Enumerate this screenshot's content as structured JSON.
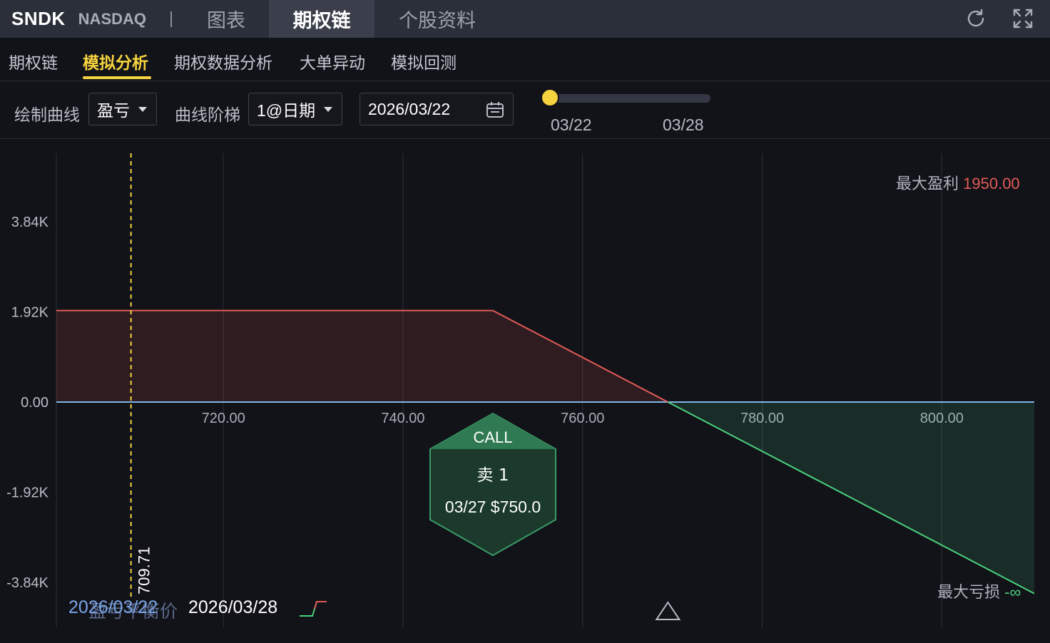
{
  "header": {
    "ticker": "SNDK",
    "exchange": "NASDAQ",
    "tabs": [
      "图表",
      "期权链",
      "个股资料"
    ],
    "active_tab": "期权链",
    "icons": [
      "refresh-icon",
      "fullscreen-icon"
    ]
  },
  "subtabs": {
    "items": [
      "期权链",
      "模拟分析",
      "期权数据分析",
      "大单异动",
      "模拟回测"
    ],
    "active": "模拟分析"
  },
  "controls": {
    "curve_label": "绘制曲线",
    "curve_value": "盈亏",
    "ladder_label": "曲线阶梯",
    "ladder_value": "1@日期",
    "date_value": "2026/03/22",
    "slider_start": "03/22",
    "slider_end": "03/28"
  },
  "chart": {
    "max_profit_label": "最大盈利",
    "max_profit_value": "1950.00",
    "max_loss_label": "最大亏损",
    "max_loss_value": "-∞",
    "current_price_label": "709.71",
    "legend_date_1": "2026/03/22",
    "legend_date_1_overlap": "盈亏平衡价",
    "legend_date_2": "2026/03/28",
    "card": {
      "type": "CALL",
      "action": "卖 1",
      "detail": "03/27 $750.0"
    }
  },
  "chart_data": {
    "type": "line",
    "x_tick_labels": [
      "720.00",
      "740.00",
      "760.00",
      "780.00",
      "800.00"
    ],
    "y_tick_labels": [
      "3.84K",
      "1.92K",
      "0.00",
      "-1.92K",
      "-3.84K"
    ],
    "xlim": [
      701.4,
      810.3
    ],
    "ylim": [
      -4800,
      5300
    ],
    "current_price": 709.71,
    "breakeven": 769.5,
    "series": [
      {
        "name": "2026/03/28",
        "points": [
          [
            701.4,
            1950
          ],
          [
            750,
            1950
          ],
          [
            769.5,
            0
          ],
          [
            810.3,
            -4080
          ]
        ]
      }
    ],
    "colors": {
      "profit": "#e15b56",
      "loss": "#4ad07c",
      "zero_line": "#7fb6e6",
      "price_line": "#f5d33e",
      "card": "#2f7a52"
    }
  }
}
